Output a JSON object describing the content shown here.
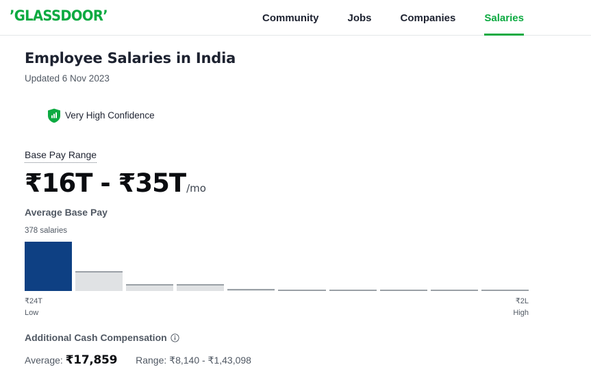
{
  "header": {
    "logo_text": "GLASSDOOR",
    "logo_color": "#0caa41",
    "nav": [
      {
        "label": "Community",
        "active": false
      },
      {
        "label": "Jobs",
        "active": false
      },
      {
        "label": "Companies",
        "active": false
      },
      {
        "label": "Salaries",
        "active": true
      }
    ]
  },
  "page": {
    "title": "Employee Salaries in India",
    "updated": "Updated 6 Nov 2023"
  },
  "confidence": {
    "icon": "shield-bar-chart-icon",
    "label": "Very High Confidence",
    "color": "#0caa41"
  },
  "base_pay": {
    "label": "Base Pay Range",
    "amount": "₹16T - ₹35T",
    "period": "/mo",
    "average_label": "Average Base Pay",
    "salaries_count": "378 salaries"
  },
  "chart_data": {
    "type": "bar",
    "title": "Average Base Pay",
    "subtitle": "378 salaries",
    "xlabel": "",
    "ylabel": "",
    "categories": [
      "1",
      "2",
      "3",
      "4",
      "5",
      "6",
      "7",
      "8",
      "9",
      "10"
    ],
    "values": [
      70,
      28,
      10,
      10,
      3,
      1,
      1,
      1,
      1,
      1
    ],
    "ylim": [
      0,
      70
    ],
    "grid": false,
    "legend": false,
    "bar_colors": [
      "#0e4083",
      "#e0e2e4",
      "#e0e2e4",
      "#e0e2e4",
      "#e0e2e4",
      "#e0e2e4",
      "#e0e2e4",
      "#e0e2e4",
      "#e0e2e4",
      "#e0e2e4"
    ],
    "axis_low_value": "₹24T",
    "axis_low_label": "Low",
    "axis_high_value": "₹2L",
    "axis_high_label": "High"
  },
  "additional_cash": {
    "title": "Additional Cash Compensation",
    "info_icon": "info-circle-icon",
    "average_label": "Average:",
    "average_value": "₹17,859",
    "range_label": "Range:",
    "range_value": "₹8,140 - ₹1,43,098"
  }
}
